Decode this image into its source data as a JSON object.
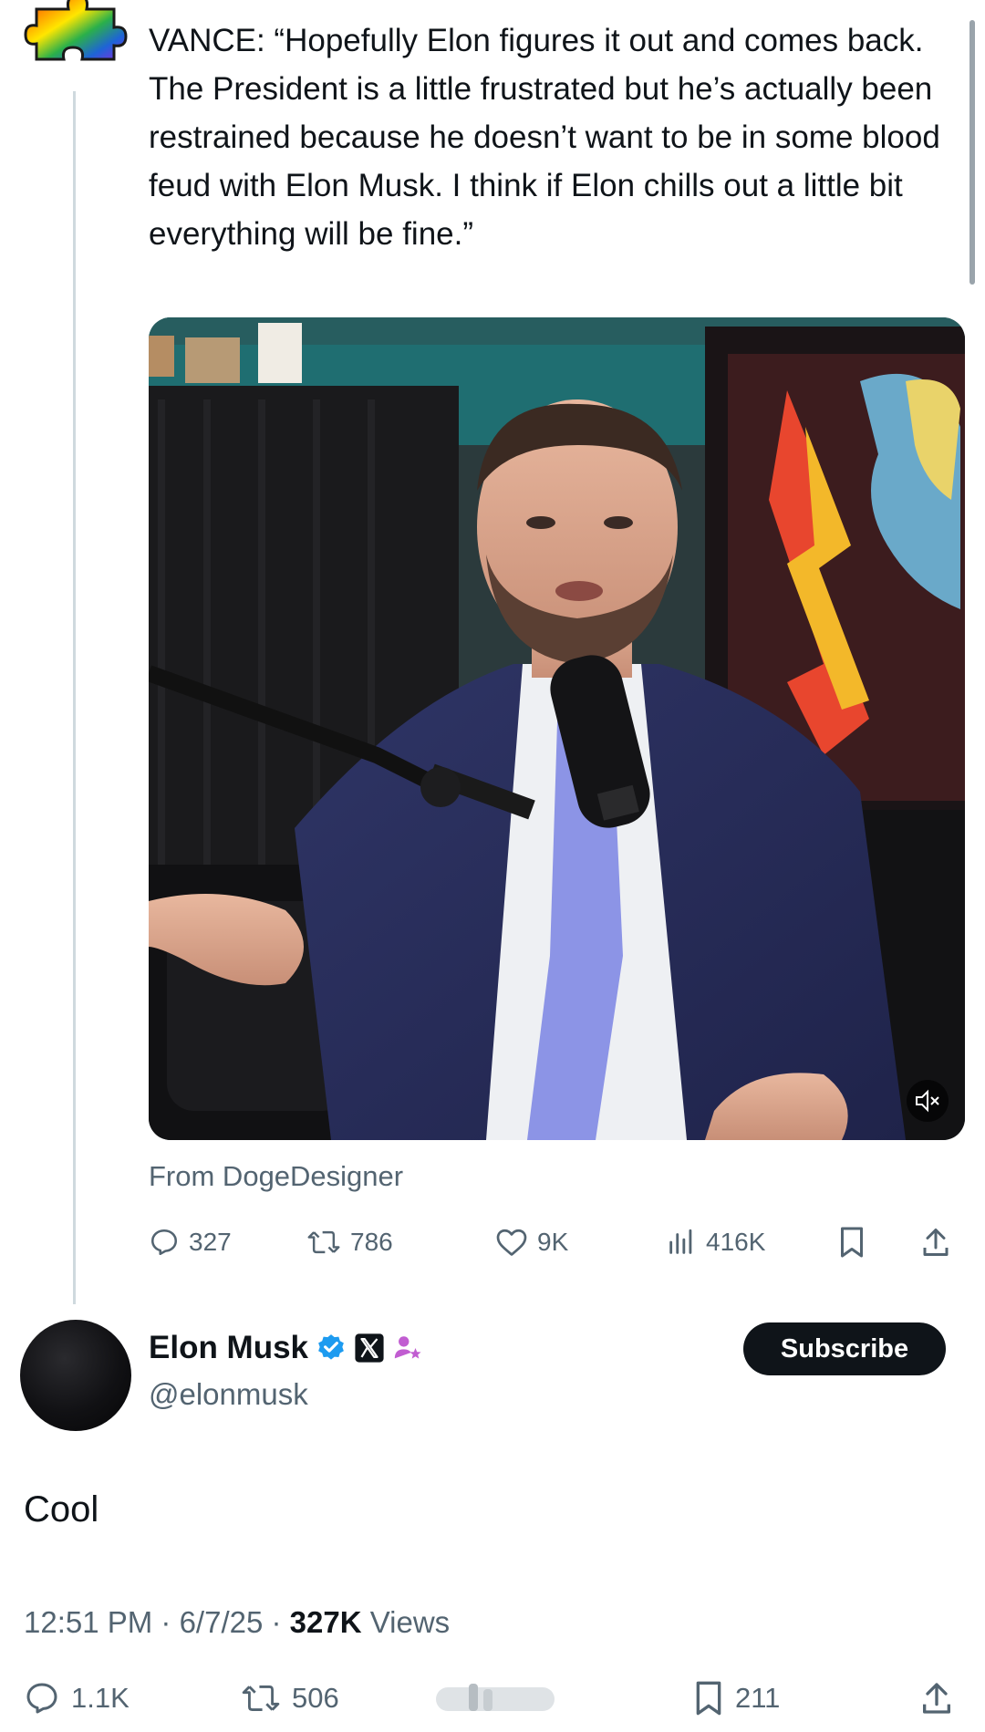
{
  "quoted_tweet": {
    "text": "VANCE: “Hopefully Elon figures it out and comes back. The President is a little frustrated but he’s actually been restrained because he doesn’t want to be in some blood feud with Elon Musk. I think if Elon chills out a little bit everything will be fine.”",
    "media_source": "From DogeDesigner",
    "stats": {
      "replies": "327",
      "reposts": "786",
      "likes": "9K",
      "views": "416K"
    }
  },
  "tweet": {
    "author_name": "Elon Musk",
    "handle": "@elonmusk",
    "subscribe_label": "Subscribe",
    "body": "Cool",
    "time": "12:51 PM",
    "date": "6/7/25",
    "views_count": "327K",
    "views_label": "Views",
    "stats": {
      "replies": "1.1K",
      "reposts": "506",
      "bookmarks": "211"
    }
  },
  "colors": {
    "verified_blue": "#1d9bf0",
    "affiliate_purple": "#c15dd1",
    "muted_text": "#536471",
    "primary_text": "#0f1419"
  },
  "icons": {
    "top_avatar": "rainbow-puzzle-icon",
    "reply": "reply-icon",
    "repost": "repost-icon",
    "like": "heart-icon",
    "views": "views-chart-icon",
    "bookmark": "bookmark-icon",
    "share": "share-icon",
    "mute": "mute-icon",
    "verified": "verified-badge-icon",
    "x_logo": "x-logo-icon",
    "affiliate": "affiliate-icon"
  }
}
